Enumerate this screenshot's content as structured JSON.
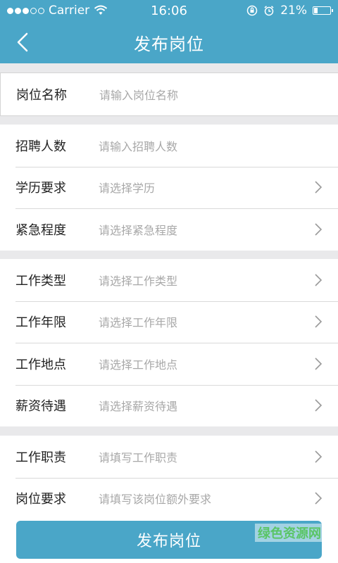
{
  "status_bar": {
    "carrier": "Carrier",
    "time": "16:06",
    "battery_text": "21%",
    "battery_level": 0.21
  },
  "nav": {
    "title": "发布岗位"
  },
  "sections": [
    [
      {
        "label": "岗位名称",
        "placeholder": "请输入岗位名称",
        "chevron": false
      }
    ],
    [
      {
        "label": "招聘人数",
        "placeholder": "请输入招聘人数",
        "chevron": false
      },
      {
        "label": "学历要求",
        "placeholder": "请选择学历",
        "chevron": true
      },
      {
        "label": "紧急程度",
        "placeholder": "请选择紧急程度",
        "chevron": true
      }
    ],
    [
      {
        "label": "工作类型",
        "placeholder": "请选择工作类型",
        "chevron": true
      },
      {
        "label": "工作年限",
        "placeholder": "请选择工作年限",
        "chevron": true
      },
      {
        "label": "工作地点",
        "placeholder": "请选择工作地点",
        "chevron": true
      },
      {
        "label": "薪资待遇",
        "placeholder": "请选择薪资待遇",
        "chevron": true
      }
    ],
    [
      {
        "label": "工作职责",
        "placeholder": "请填写工作职责",
        "chevron": true
      },
      {
        "label": "岗位要求",
        "placeholder": "请填写该岗位额外要求",
        "chevron": true
      }
    ]
  ],
  "submit": {
    "label": "发布岗位"
  },
  "watermark": {
    "text": "绿色资源网"
  },
  "colors": {
    "accent": "#4aa6c8",
    "background": "#e9e9eb"
  }
}
